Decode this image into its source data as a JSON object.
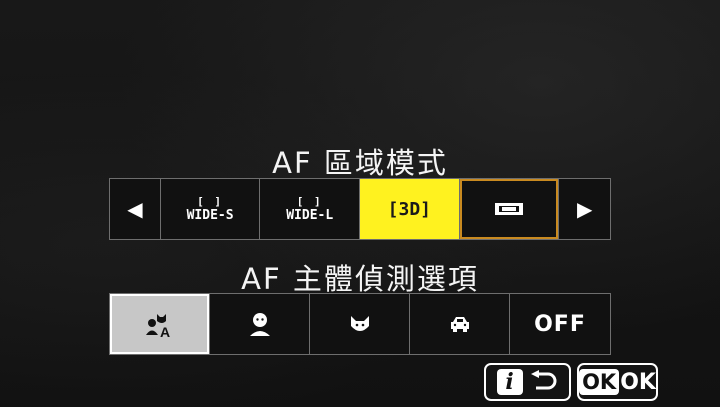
{
  "af_area_mode": {
    "title": "AF 區域模式",
    "options": [
      {
        "label": "WIDE-S",
        "icon": "wide-small-area-icon"
      },
      {
        "label": "WIDE-L",
        "icon": "wide-large-area-icon"
      },
      {
        "label": "[3D]",
        "icon": "3d-tracking-icon",
        "state": "highlighted"
      },
      {
        "label": "",
        "icon": "auto-area-icon",
        "state": "selected"
      }
    ],
    "nav_left": "◀",
    "nav_right": "▶"
  },
  "subject_detection": {
    "title": "AF 主體偵測選項",
    "options": [
      {
        "icon": "auto-subject-icon",
        "state": "selected"
      },
      {
        "icon": "person-icon"
      },
      {
        "icon": "animal-icon"
      },
      {
        "icon": "vehicle-icon"
      },
      {
        "label": "OFF"
      }
    ]
  },
  "footer": {
    "i_label": "i",
    "ok_label": "OK",
    "ok_suffix": "OK"
  },
  "colors": {
    "highlight_yellow": "#fff21f",
    "selected_outline": "#c98a20",
    "selected_gray": "#c7c7c7"
  }
}
